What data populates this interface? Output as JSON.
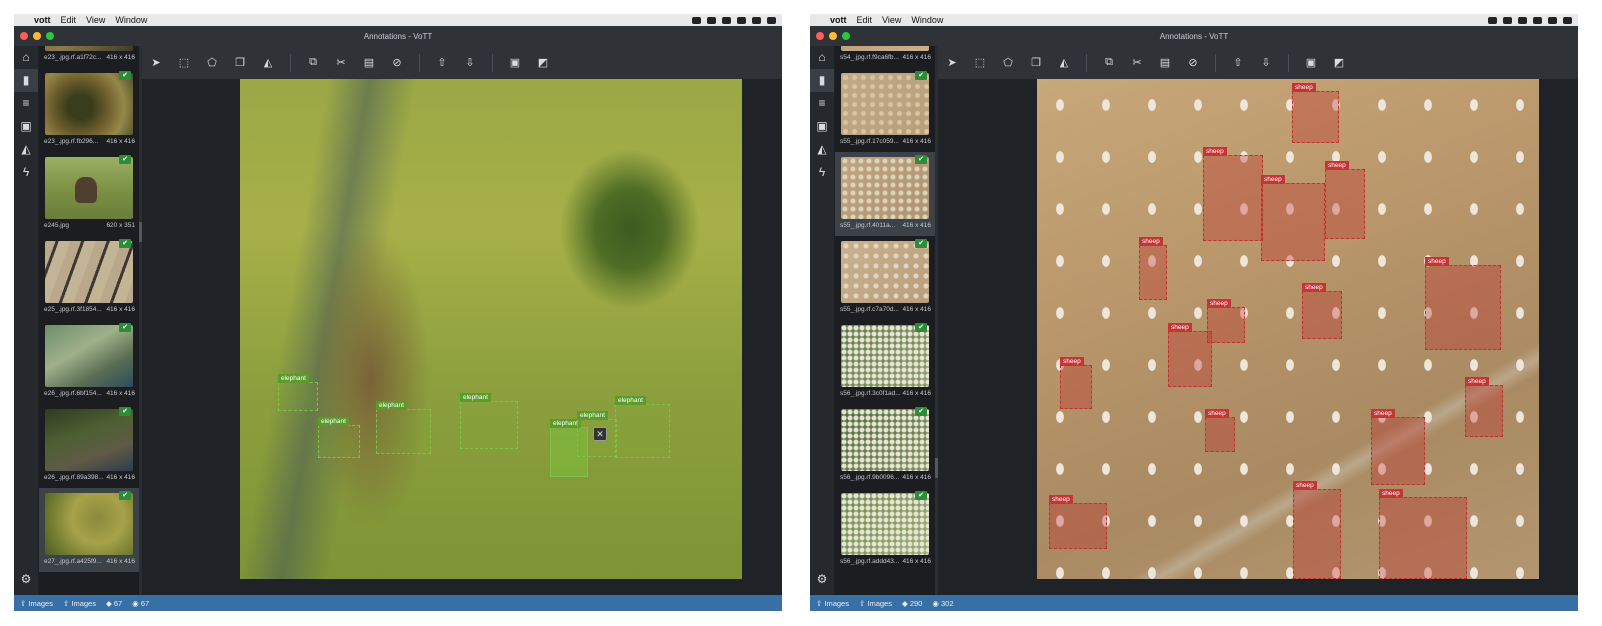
{
  "menubar": {
    "apple": "",
    "app": "vott",
    "menus": [
      "Edit",
      "View",
      "Window"
    ]
  },
  "window_title": "Annotations - VoTT",
  "left": {
    "thumbnails": [
      {
        "name": "e23_.jpg.rf.a1f72c...",
        "size": "416 x 416",
        "tagged": true
      },
      {
        "name": "e23_.jpg.rf.fb296...",
        "size": "416 x 416",
        "tagged": true
      },
      {
        "name": "e245.jpg",
        "size": "620 x 351",
        "tagged": true
      },
      {
        "name": "e25_.jpg.rf.3f1854...",
        "size": "416 x 416",
        "tagged": true
      },
      {
        "name": "e26_.jpg.rf.6bf154...",
        "size": "416 x 416",
        "tagged": true
      },
      {
        "name": "e26_.jpg.rf.89a398...",
        "size": "416 x 416",
        "tagged": true
      },
      {
        "name": "e27_.jpg.rf.a425f9...",
        "size": "416 x 416",
        "tagged": true
      }
    ],
    "region_label": "elephant",
    "status": {
      "images1": "Images",
      "images2": "Images",
      "tags": "67",
      "visited": "67"
    }
  },
  "right": {
    "thumbnails": [
      {
        "name": "s54_.jpg.rf.f9ca6fb...",
        "size": "416 x 416",
        "tagged": true
      },
      {
        "name": "s55_.jpg.rf.17c059...",
        "size": "416 x 416",
        "tagged": true
      },
      {
        "name": "s55_.jpg.rf.4011a...",
        "size": "416 x 416",
        "tagged": true
      },
      {
        "name": "s55_.jpg.rf.c7a70d...",
        "size": "416 x 416",
        "tagged": true
      },
      {
        "name": "s56_.jpg.rf.3c0f1ad...",
        "size": "416 x 416",
        "tagged": true
      },
      {
        "name": "s56_.jpg.rf.9b0096...",
        "size": "416 x 416",
        "tagged": true
      },
      {
        "name": "s56_.jpg.rf.addd43...",
        "size": "416 x 416",
        "tagged": true
      }
    ],
    "region_label": "sheep",
    "status": {
      "images1": "Images",
      "images2": "Images",
      "tags": "290",
      "visited": "302"
    }
  },
  "icons": {
    "rail": [
      "home-icon",
      "bookmark-icon",
      "sliders-icon",
      "image-export-icon",
      "graduation-cap-icon",
      "plug-icon",
      "gear-icon"
    ],
    "toolbar": [
      "pointer-icon",
      "rectangle-icon",
      "polygon-icon",
      "copy-rectangle-icon",
      "active-learning-icon",
      "copy-icon",
      "cut-icon",
      "paste-icon",
      "clear-icon",
      "previous-icon",
      "next-icon",
      "save-icon",
      "export-icon"
    ]
  },
  "colors": {
    "status_bar": "#386fa4",
    "elephant_tag": "#5a9b2c",
    "sheep_tag": "#c43535",
    "tag_badge": "#2e8b3a"
  }
}
